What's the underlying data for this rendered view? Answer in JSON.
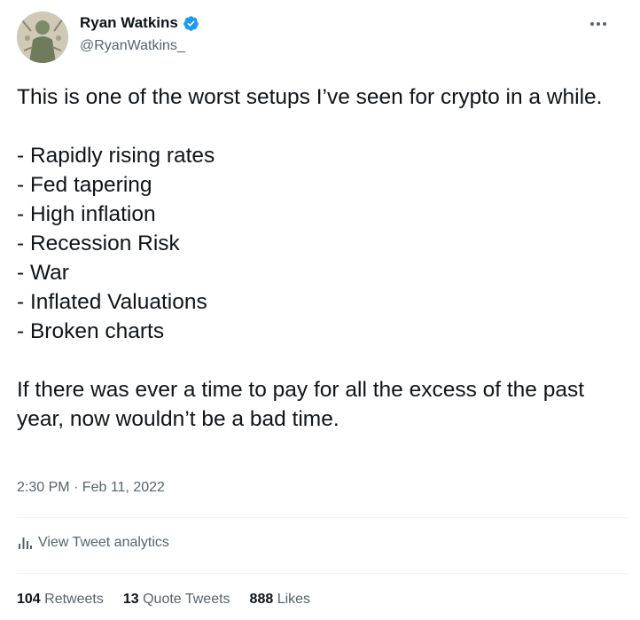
{
  "author": {
    "display_name": "Ryan Watkins",
    "handle": "@RyanWatkins_",
    "verified_icon": "verified-badge-icon",
    "accent_color": "#1d9bf0"
  },
  "tweet": {
    "intro": "This is one of the worst setups I’ve seen for crypto in a while.",
    "list": [
      "- Rapidly rising rates",
      "- Fed tapering",
      "- High inflation",
      "- Recession Risk",
      "- War",
      "- Inflated Valuations",
      "- Broken charts"
    ],
    "outro": "If there was ever a time to pay for all the excess of the past year, now wouldn’t be a bad time."
  },
  "timestamp": "2:30 PM · Feb 11, 2022",
  "analytics_label": "View Tweet analytics",
  "stats": {
    "retweets_count": "104",
    "retweets_label": "Retweets",
    "quotes_count": "13",
    "quotes_label": "Quote Tweets",
    "likes_count": "888",
    "likes_label": "Likes"
  }
}
